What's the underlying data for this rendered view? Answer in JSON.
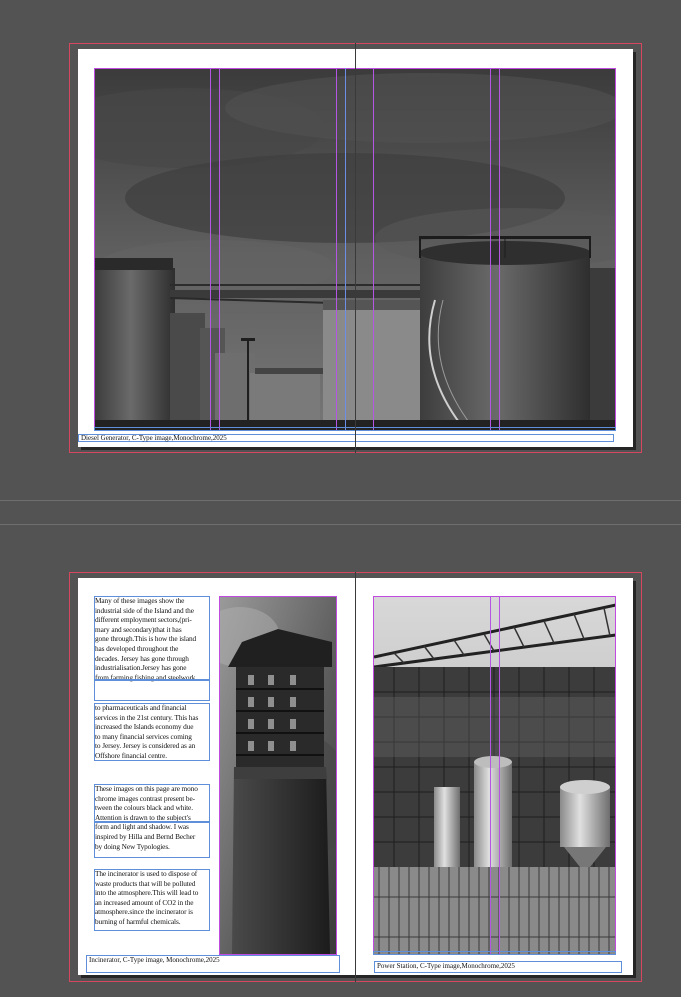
{
  "spread1": {
    "caption": "Diesel Generator, C-Type image,Monochrome,2025",
    "image_icon": "photo-diesel-generator-tanks"
  },
  "spread2": {
    "left_caption": "Incinerator, C-Type image, Monochrome,2025",
    "right_caption": "Power Station, C-Type image,Monochrome,2025",
    "paragraphs": [
      "Many of these images show the\nindustrial side of the Island and the\ndifferent  employment sectors,(pri-\nmary and secondary)that it has\ngone through.This is how the island\nhas developed  throughout the\ndecades. Jersey has gone through\nindustrialisation.Jersey has gone\nfrom farming,fishing and steelwork",
      "to pharmaceuticals and  financial\nservices in the 21st century. This has\nincreased the Islands economy due\nto many financial services coming\nto Jersey. Jersey is considered as an\nOffshore  financial centre.",
      "These images on this page are mono\nchrome images contrast present be-\ntween the colours black and white.\nAttention is drawn to the subject's\nform and light and shadow. I was\ninspired by Hilla and Bernd Becher\nby doing New Typologies.",
      "The incinerator is used to dispose of\nwaste products  that will be polluted\ninto the atmosphere.This will lead to\nan increased amount of CO2 in the\natmosphere.since the incinerator is\nburning of harmful chemicals."
    ]
  },
  "colors": {
    "pasteboard": "#535353",
    "bleed_guide": "#d4475e",
    "margin_guide": "#c14ae0",
    "frame_edge": "#5f8fd8"
  }
}
